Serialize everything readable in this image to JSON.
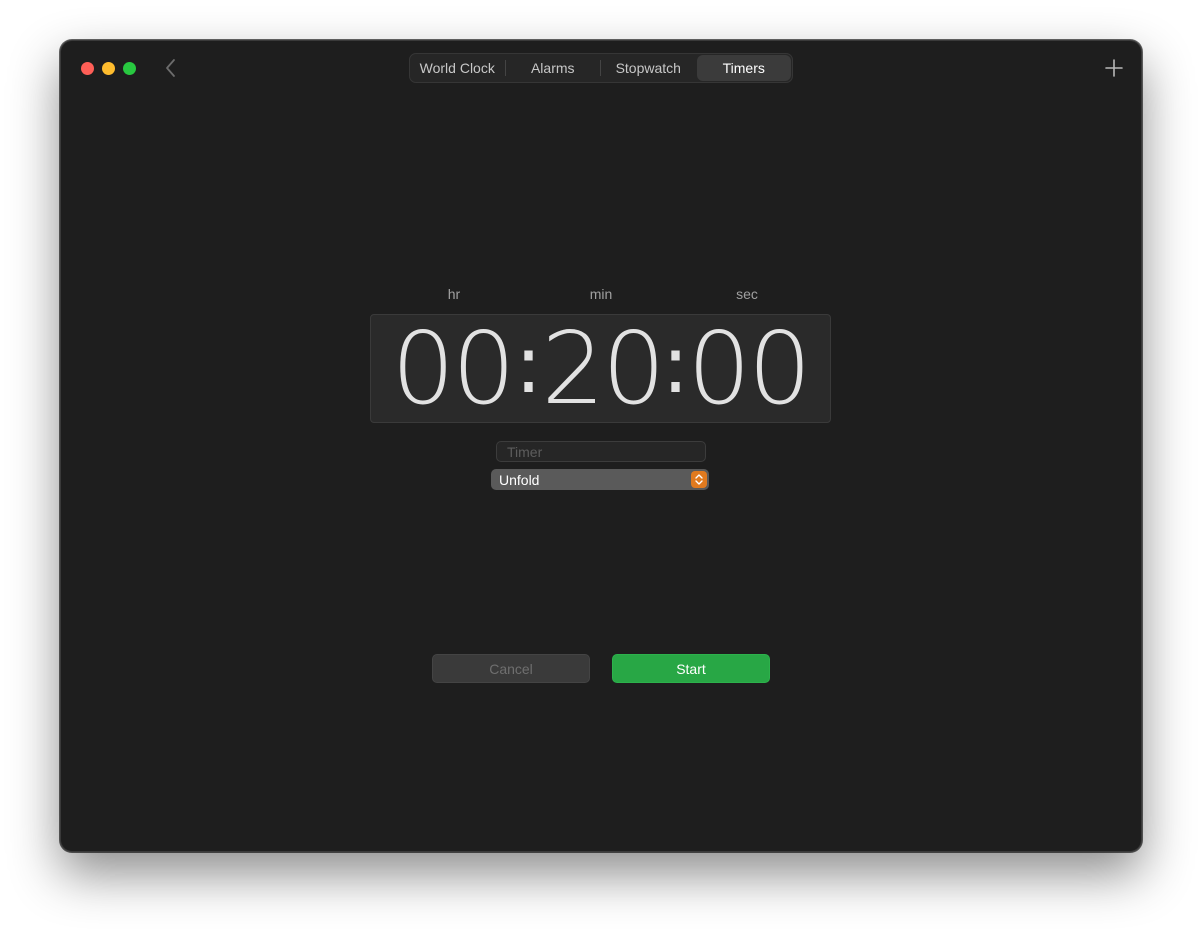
{
  "tabs": [
    {
      "label": "World Clock",
      "active": false
    },
    {
      "label": "Alarms",
      "active": false
    },
    {
      "label": "Stopwatch",
      "active": false
    },
    {
      "label": "Timers",
      "active": true
    }
  ],
  "timer": {
    "units": {
      "hr": "hr",
      "min": "min",
      "sec": "sec"
    },
    "hours": "00",
    "minutes": "20",
    "seconds": "00",
    "separator": ":"
  },
  "label_field": {
    "value": "",
    "placeholder": "Timer"
  },
  "sound_select": {
    "value": "Unfold"
  },
  "buttons": {
    "cancel": "Cancel",
    "start": "Start"
  },
  "icons": {
    "back": "chevron-left-icon",
    "add": "plus-icon",
    "stepper": "up-down-chevron-icon"
  },
  "colors": {
    "accent_green": "#28a745",
    "accent_orange": "#e07a1f",
    "close": "#fe5f57",
    "minimize": "#febc2e",
    "maximize": "#28c840",
    "window_bg": "#1e1e1e"
  }
}
